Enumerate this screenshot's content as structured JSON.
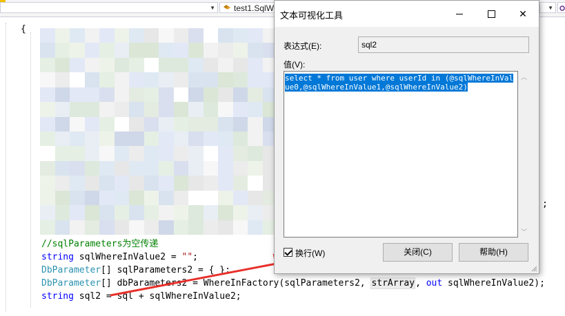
{
  "toolbar": {
    "left_dropdown_value": "",
    "member_dropdown_value": "test1.SqlW",
    "right_dropdown_value": ""
  },
  "editor": {
    "open_brace": "{",
    "comment_line": "//sqlParameters为空传递",
    "line1": {
      "type": "string",
      "rest_a": " sqlWhereInValue2 = ",
      "literal": "\"\"",
      "rest_b": ";"
    },
    "line2": {
      "type": "DbParameter",
      "rest": "[] sqlParameters2 = { };"
    },
    "line3": {
      "type": "DbParameter",
      "rest_a": "[] dbParameters2 = WhereInFactory(sqlParameters2, ",
      "highlight": "strArray",
      "rest_b": ", ",
      "out": "out",
      "rest_c": " sqlWhereInValue2);"
    },
    "line4": "string sql2 = sql + sqlWhereInValue2;",
    "semicolon": ";"
  },
  "dialog": {
    "title": "文本可视化工具",
    "expression_label": "表达式(E):",
    "expression_value": "sql2",
    "value_label": "值(V):",
    "value_text": "select * from user where userId in (@sqlWhereInValue0,@sqlWhereInValue1,@sqlWhereInValue2)",
    "wrap_label": "换行(W)",
    "wrap_checked": true,
    "close_button": "关闭(C)",
    "help_button": "帮助(H)",
    "minimize_icon": "minimize-icon",
    "maximize_icon": "maximize-icon",
    "close_icon": "close-icon"
  },
  "colors": {
    "keyword": "#0000ff",
    "type": "#2b91af",
    "comment": "#008000",
    "string": "#a31515",
    "selection": "#0078d7",
    "arrow": "#e8302a"
  }
}
